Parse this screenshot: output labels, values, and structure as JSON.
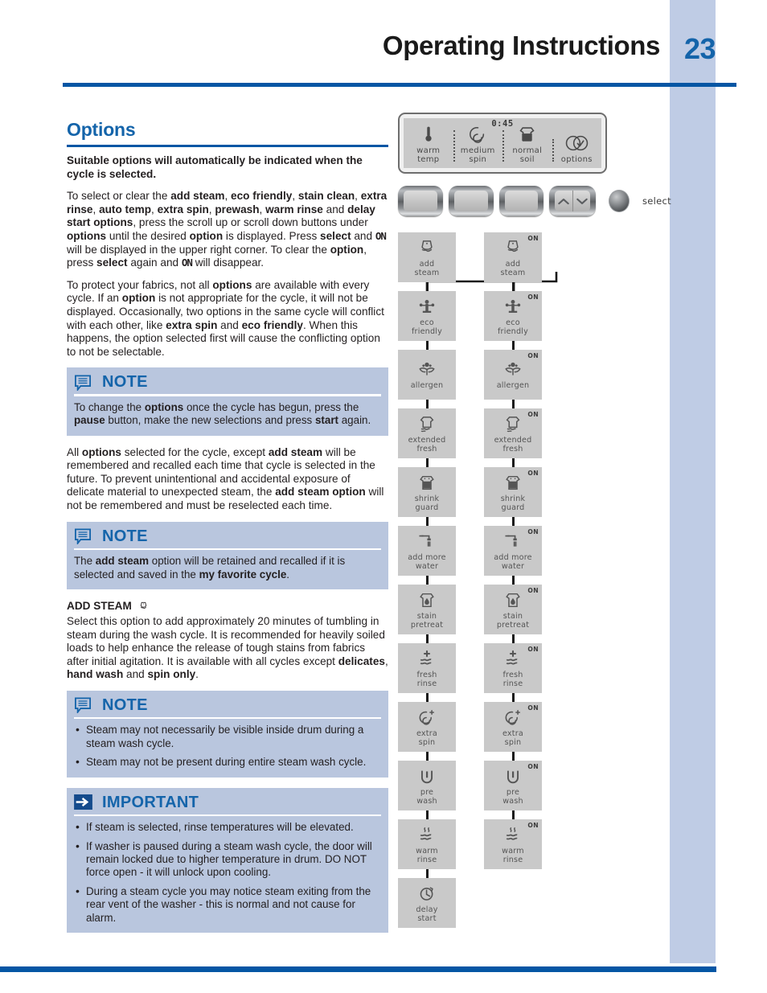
{
  "header": {
    "title": "Operating Instructions",
    "page_number": "23"
  },
  "left": {
    "section_title": "Options",
    "lead_paragraph": "Suitable options will automatically be indicated when the cycle is selected.",
    "paragraph_2_runs": [
      {
        "t": "To select or clear the ",
        "b": false
      },
      {
        "t": "add steam",
        "b": true
      },
      {
        "t": ", ",
        "b": false
      },
      {
        "t": "eco friendly",
        "b": true
      },
      {
        "t": ", ",
        "b": false
      },
      {
        "t": "stain clean",
        "b": true
      },
      {
        "t": ", ",
        "b": false
      },
      {
        "t": "extra rinse",
        "b": true
      },
      {
        "t": ", ",
        "b": false
      },
      {
        "t": "auto temp",
        "b": true
      },
      {
        "t": ", ",
        "b": false
      },
      {
        "t": "extra spin",
        "b": true
      },
      {
        "t": ", ",
        "b": false
      },
      {
        "t": "prewash",
        "b": true
      },
      {
        "t": ", ",
        "b": false
      },
      {
        "t": "warm rinse",
        "b": true
      },
      {
        "t": " and ",
        "b": false
      },
      {
        "t": "delay start options",
        "b": true
      },
      {
        "t": ", press the scroll up or scroll down buttons under ",
        "b": false
      },
      {
        "t": "options",
        "b": true
      },
      {
        "t": " until the desired ",
        "b": false
      },
      {
        "t": "option",
        "b": true
      },
      {
        "t": " is displayed. Press ",
        "b": false
      },
      {
        "t": "select",
        "b": true
      },
      {
        "t": " and ",
        "b": false
      },
      {
        "t": "ON",
        "b": true,
        "glyph": true
      },
      {
        "t": " will be displayed in the upper right corner. To clear the ",
        "b": false
      },
      {
        "t": "option",
        "b": true
      },
      {
        "t": ", press ",
        "b": false
      },
      {
        "t": "select",
        "b": true
      },
      {
        "t": " again and ",
        "b": false
      },
      {
        "t": "ON",
        "b": true,
        "glyph": true
      },
      {
        "t": " will disappear.",
        "b": false
      }
    ],
    "paragraph_3_runs": [
      {
        "t": "To protect your fabrics, not all ",
        "b": false
      },
      {
        "t": "options",
        "b": true
      },
      {
        "t": " are available with every cycle. If an ",
        "b": false
      },
      {
        "t": "option",
        "b": true
      },
      {
        "t": " is not appropriate for the cycle, it will not be displayed. Occasionally, two options in the same cycle will conflict with each other, like ",
        "b": false
      },
      {
        "t": "extra spin",
        "b": true
      },
      {
        "t": " and ",
        "b": false
      },
      {
        "t": "eco friendly",
        "b": true
      },
      {
        "t": ". When this happens, the option selected first will cause the conflicting option to not be selectable.",
        "b": false
      }
    ],
    "note_1": {
      "title": "NOTE",
      "icon": "speech-bubble-icon",
      "body_runs": [
        {
          "t": "To change the ",
          "b": false
        },
        {
          "t": "options",
          "b": true
        },
        {
          "t": " once the cycle has begun, press the ",
          "b": false
        },
        {
          "t": "pause",
          "b": true
        },
        {
          "t": " button, make the new selections and press ",
          "b": false
        },
        {
          "t": "start",
          "b": true
        },
        {
          "t": " again.",
          "b": false
        }
      ]
    },
    "paragraph_4_runs": [
      {
        "t": "All ",
        "b": false
      },
      {
        "t": "options",
        "b": true
      },
      {
        "t": " selected for the cycle, except ",
        "b": false
      },
      {
        "t": "add steam",
        "b": true
      },
      {
        "t": " will be remembered and recalled each time that cycle is selected in the future. To prevent unintentional and accidental exposure of delicate material to unexpected steam, the ",
        "b": false
      },
      {
        "t": "add steam option",
        "b": true
      },
      {
        "t": " will not be remembered and must be reselected each time.",
        "b": false
      }
    ],
    "note_2": {
      "title": "NOTE",
      "icon": "speech-bubble-icon",
      "body_runs": [
        {
          "t": "The ",
          "b": false
        },
        {
          "t": "add steam",
          "b": true
        },
        {
          "t": " option will be retained and recalled if it is selected and saved in the ",
          "b": false
        },
        {
          "t": "my favorite cycle",
          "b": true
        },
        {
          "t": ".",
          "b": false
        }
      ]
    },
    "add_steam_heading": "ADD STEAM",
    "add_steam_heading_icon": "steam-icon",
    "paragraph_5_runs": [
      {
        "t": "Select this option to add approximately 20 minutes of tumbling in steam during the wash cycle. It is recommended for heavily soiled loads to help enhance the release of tough stains from fabrics after initial agitation. It is available with all cycles except ",
        "b": false
      },
      {
        "t": "delicates",
        "b": true
      },
      {
        "t": ", ",
        "b": false
      },
      {
        "t": "hand wash",
        "b": true
      },
      {
        "t": " and ",
        "b": false
      },
      {
        "t": "spin only",
        "b": true
      },
      {
        "t": ".",
        "b": false
      }
    ],
    "note_3": {
      "title": "NOTE",
      "icon": "speech-bubble-icon",
      "bullets": [
        "Steam may not necessarily be visible inside drum during a steam wash cycle.",
        "Steam may not be present during entire steam wash cycle."
      ]
    },
    "important": {
      "title": "IMPORTANT",
      "icon": "arrow-right-icon",
      "bullets": [
        "If steam is selected, rinse temperatures will be elevated.",
        "If washer is paused during a steam wash cycle, the door will remain locked due to higher temperature in drum. DO NOT force open - it will unlock upon cooling.",
        "During a steam cycle you may notice steam exiting from the rear vent of the washer - this is normal and not cause for alarm."
      ]
    }
  },
  "right": {
    "lcd": {
      "time": "0:45",
      "cells": [
        {
          "label_line1": "warm",
          "label_line2": "temp",
          "icon": "thermometer-icon"
        },
        {
          "label_line1": "medium",
          "label_line2": "spin",
          "icon": "spiral-icon"
        },
        {
          "label_line1": "normal",
          "label_line2": "soil",
          "icon": "shirt-icon"
        },
        {
          "label_line1": "options",
          "label_line2": "",
          "icon": "options-circles-icon"
        }
      ]
    },
    "buttons": [
      {
        "name": "button-1",
        "type": "plain"
      },
      {
        "name": "button-2",
        "type": "plain"
      },
      {
        "name": "button-3",
        "type": "plain"
      },
      {
        "name": "scroll-button",
        "type": "scroll"
      }
    ],
    "select_knob_label": "select",
    "on_indicator": "ON",
    "options_left": [
      {
        "label_line1": "add",
        "label_line2": "steam",
        "icon": "steam-icon"
      },
      {
        "label_line1": "eco",
        "label_line2": "friendly",
        "icon": "eco-icon"
      },
      {
        "label_line1": "allergen",
        "label_line2": "",
        "icon": "flower-icon"
      },
      {
        "label_line1": "extended",
        "label_line2": "fresh",
        "icon": "shirt-waves-icon"
      },
      {
        "label_line1": "shrink",
        "label_line2": "guard",
        "icon": "shirt-icon"
      },
      {
        "label_line1": "add more",
        "label_line2": "water",
        "icon": "faucet-icon"
      },
      {
        "label_line1": "stain",
        "label_line2": "pretreat",
        "icon": "shirt-droplet-icon"
      },
      {
        "label_line1": "fresh",
        "label_line2": "rinse",
        "icon": "plus-waves-icon"
      },
      {
        "label_line1": "extra",
        "label_line2": "spin",
        "icon": "spiral-plus-icon"
      },
      {
        "label_line1": "pre",
        "label_line2": "wash",
        "icon": "tub-icon"
      },
      {
        "label_line1": "warm",
        "label_line2": "rinse",
        "icon": "steam-waves-icon"
      },
      {
        "label_line1": "delay",
        "label_line2": "start",
        "icon": "clock-icon"
      }
    ],
    "options_right": [
      {
        "label_line1": "add",
        "label_line2": "steam",
        "icon": "steam-icon",
        "on": "ON"
      },
      {
        "label_line1": "eco",
        "label_line2": "friendly",
        "icon": "eco-icon",
        "on": "ON"
      },
      {
        "label_line1": "allergen",
        "label_line2": "",
        "icon": "flower-icon",
        "on": "ON"
      },
      {
        "label_line1": "extended",
        "label_line2": "fresh",
        "icon": "shirt-waves-icon",
        "on": "ON"
      },
      {
        "label_line1": "shrink",
        "label_line2": "guard",
        "icon": "shirt-icon",
        "on": "ON"
      },
      {
        "label_line1": "add more",
        "label_line2": "water",
        "icon": "faucet-icon",
        "on": "ON"
      },
      {
        "label_line1": "stain",
        "label_line2": "pretreat",
        "icon": "shirt-droplet-icon",
        "on": "ON"
      },
      {
        "label_line1": "fresh",
        "label_line2": "rinse",
        "icon": "plus-waves-icon",
        "on": "ON"
      },
      {
        "label_line1": "extra",
        "label_line2": "spin",
        "icon": "spiral-plus-icon",
        "on": "ON"
      },
      {
        "label_line1": "pre",
        "label_line2": "wash",
        "icon": "tub-icon",
        "on": "ON"
      },
      {
        "label_line1": "warm",
        "label_line2": "rinse",
        "icon": "steam-waves-icon",
        "on": "ON"
      }
    ]
  },
  "colors": {
    "accent_blue": "#1464aa",
    "rule_blue": "#0556a4",
    "sidebar_blue": "#bfcce5",
    "callout_bg": "#b9c6de",
    "tile_gray": "#c9c9c9"
  }
}
